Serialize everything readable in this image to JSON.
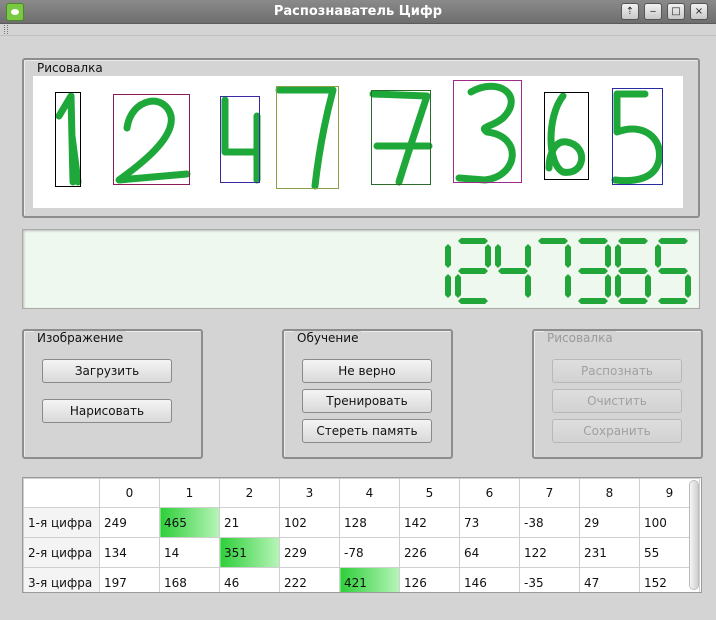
{
  "window": {
    "title": "Распознаватель Цифр",
    "icon": "app-icon",
    "controls": [
      "up-arrow-icon",
      "minimize-icon",
      "maximize-icon",
      "close-icon"
    ],
    "control_glyphs": [
      "⇡",
      "‒",
      "□",
      "×"
    ]
  },
  "drawing_group": {
    "title": "Рисовалка",
    "strokes_color": "#1fa83a",
    "digits": [
      {
        "digit": "1",
        "box_color": "#000000"
      },
      {
        "digit": "2",
        "box_color": "#8b1a5a"
      },
      {
        "digit": "4",
        "box_color": "#3a2aa0"
      },
      {
        "digit": "7",
        "box_color": "#8aa048"
      },
      {
        "digit": "7",
        "box_color": "#2a6a2a"
      },
      {
        "digit": "3",
        "box_color": "#a02a8a"
      },
      {
        "digit": "6",
        "box_color": "#000000"
      },
      {
        "digit": "5",
        "box_color": "#2a2aa0"
      }
    ]
  },
  "lcd": {
    "value": "1247365",
    "color": "#22a63a"
  },
  "image_group": {
    "title": "Изображение",
    "load_label": "Загрузить",
    "draw_label": "Нарисовать"
  },
  "training_group": {
    "title": "Обучение",
    "wrong_label": "Не верно",
    "train_label": "Тренировать",
    "erase_label": "Стереть память"
  },
  "draw_panel_group": {
    "title": "Рисовалка",
    "recognize_label": "Распознать",
    "clear_label": "Очистить",
    "save_label": "Сохранить"
  },
  "table": {
    "columns": [
      "0",
      "1",
      "2",
      "3",
      "4",
      "5",
      "6",
      "7",
      "8",
      "9"
    ],
    "highlight_color": "#2ecf3a",
    "rows": [
      {
        "label": "1-я цифра",
        "values": [
          "249",
          "465",
          "21",
          "102",
          "128",
          "142",
          "73",
          "-38",
          "29",
          "100"
        ],
        "highlight": 1
      },
      {
        "label": "2-я цифра",
        "values": [
          "134",
          "14",
          "351",
          "229",
          "-78",
          "226",
          "64",
          "122",
          "231",
          "55"
        ],
        "highlight": 2
      },
      {
        "label": "3-я цифра",
        "values": [
          "197",
          "168",
          "46",
          "222",
          "421",
          "126",
          "146",
          "-35",
          "47",
          "152"
        ],
        "highlight": 4
      }
    ]
  }
}
